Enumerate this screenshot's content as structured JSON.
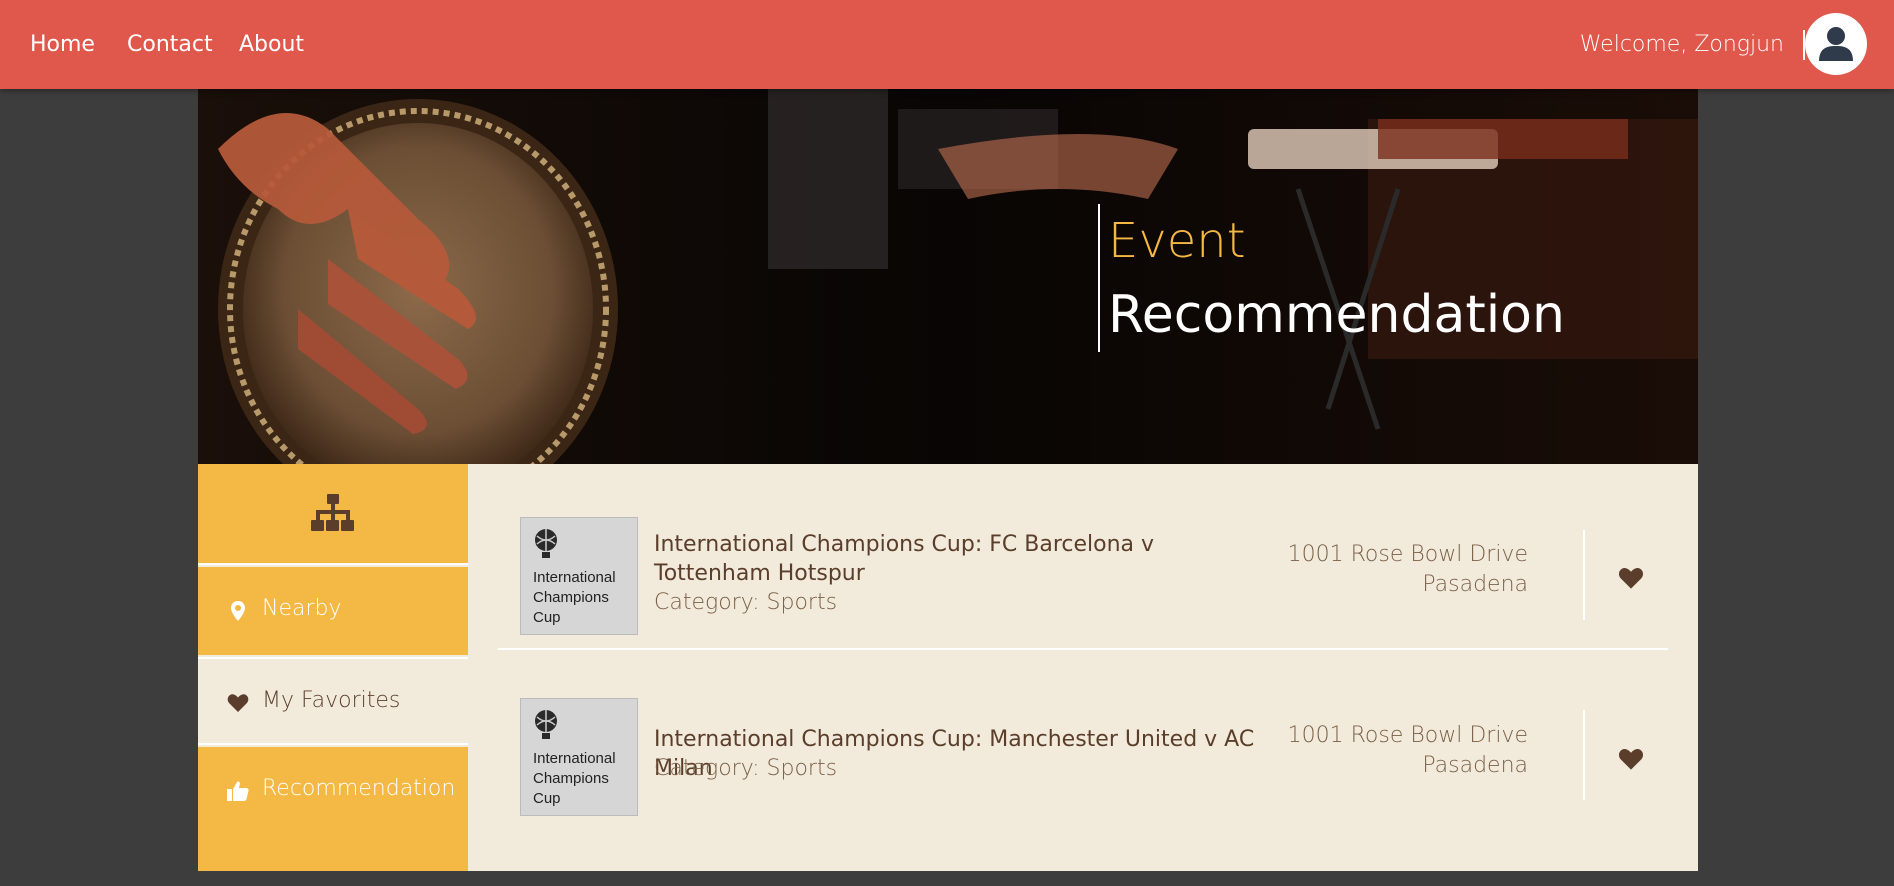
{
  "nav": {
    "links": [
      "Home",
      "Contact",
      "About"
    ],
    "welcome": "Welcome, Zongjun"
  },
  "hero": {
    "line1": "Event",
    "line2": "Recommendation"
  },
  "sidebar": {
    "items": [
      {
        "label": "Nearby",
        "icon": "map-marker-icon"
      },
      {
        "label": "My Favorites",
        "icon": "heart-icon"
      },
      {
        "label": "Recommendation",
        "icon": "thumbs-up-icon"
      }
    ]
  },
  "events": [
    {
      "name": "International Champions Cup: FC Barcelona v Tottenham Hotspur",
      "category": "Category: Sports",
      "address_line1": "1001 Rose Bowl Drive",
      "address_line2": "Pasadena",
      "image_text": [
        "International",
        "Champions",
        "Cup"
      ]
    },
    {
      "name": "International Champions Cup: Manchester United v AC Milan",
      "category": "Category: Sports",
      "address_line1": "1001 Rose Bowl Drive",
      "address_line2": "Pasadena",
      "image_text": [
        "International",
        "Champions",
        "Cup"
      ]
    }
  ],
  "colors": {
    "nav": "#e0584c",
    "accent": "#f3b944",
    "panel": "#f2eada",
    "background": "#3d3d3d",
    "text_brown": "#5a3e2b"
  }
}
